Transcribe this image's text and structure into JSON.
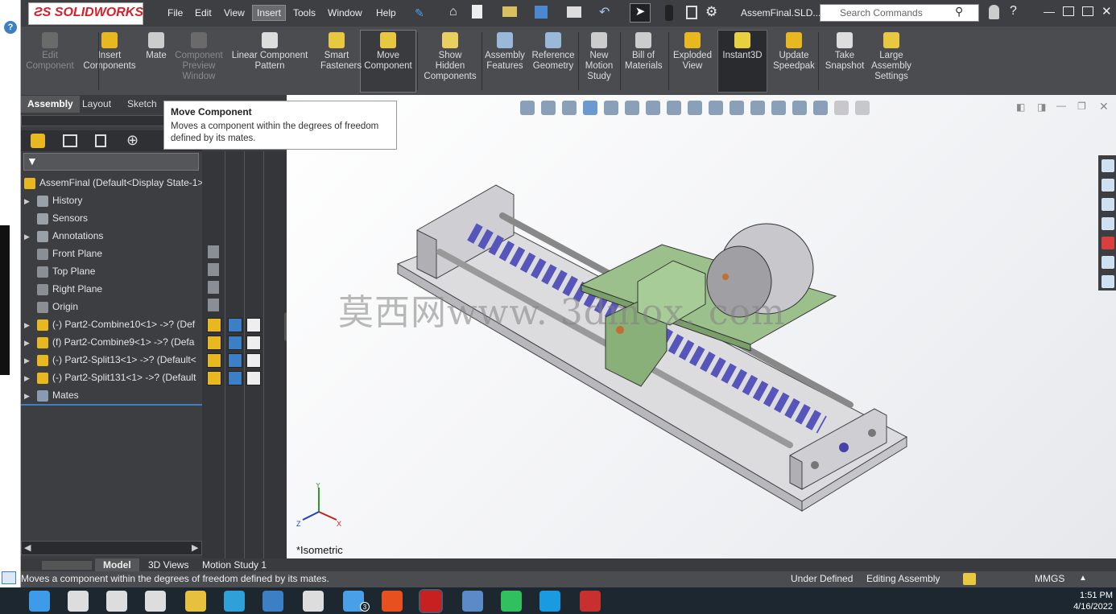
{
  "app": {
    "logo": "SOLIDWORKS",
    "document": "AssemFinal.SLD..."
  },
  "menu": [
    "File",
    "Edit",
    "View",
    "Insert",
    "Tools",
    "Window",
    "Help"
  ],
  "search": {
    "placeholder": "Search Commands"
  },
  "ribbon": [
    {
      "label": "Edit Component",
      "disabled": true,
      "icon": "edit-component-icon"
    },
    {
      "label": "Insert Components",
      "disabled": false,
      "icon": "insert-components-icon"
    },
    {
      "label": "Mate",
      "disabled": false,
      "icon": "mate-icon"
    },
    {
      "label": "Component Preview Window",
      "disabled": true,
      "icon": "preview-window-icon"
    },
    {
      "label": "Linear Component Pattern",
      "disabled": false,
      "icon": "linear-pattern-icon"
    },
    {
      "label": "Smart Fasteners",
      "disabled": false,
      "icon": "smart-fasteners-icon"
    },
    {
      "label": "Move Component",
      "disabled": false,
      "icon": "move-component-icon"
    },
    {
      "label": "Show Hidden Components",
      "disabled": false,
      "icon": "show-hidden-icon"
    },
    {
      "label": "Assembly Features",
      "disabled": false,
      "icon": "assembly-features-icon"
    },
    {
      "label": "Reference Geometry",
      "disabled": false,
      "icon": "reference-geometry-icon"
    },
    {
      "label": "New Motion Study",
      "disabled": false,
      "icon": "motion-study-icon"
    },
    {
      "label": "Bill of Materials",
      "disabled": false,
      "icon": "bom-icon"
    },
    {
      "label": "Exploded View",
      "disabled": false,
      "icon": "exploded-view-icon"
    },
    {
      "label": "Instant3D",
      "disabled": false,
      "icon": "instant3d-icon"
    },
    {
      "label": "Update Speedpak",
      "disabled": false,
      "icon": "speedpak-icon"
    },
    {
      "label": "Take Snapshot",
      "disabled": false,
      "icon": "snapshot-icon"
    },
    {
      "label": "Large Assembly Settings",
      "disabled": false,
      "icon": "large-assembly-icon"
    }
  ],
  "tabs": [
    "Assembly",
    "Layout",
    "Sketch"
  ],
  "tooltip": {
    "title": "Move Component",
    "body": "Moves a component within the degrees of freedom defined by its mates."
  },
  "tree": [
    {
      "label": "AssemFinal  (Default<Display State-1>",
      "arrow": false,
      "icon_color": "#e8b820"
    },
    {
      "label": "History",
      "arrow": true,
      "icon_color": "#9aa0a8"
    },
    {
      "label": "Sensors",
      "arrow": false,
      "icon_color": "#9aa0a8"
    },
    {
      "label": "Annotations",
      "arrow": true,
      "icon_color": "#9aa0a8"
    },
    {
      "label": "Front Plane",
      "arrow": false,
      "icon_color": "#8a8f96"
    },
    {
      "label": "Top Plane",
      "arrow": false,
      "icon_color": "#8a8f96"
    },
    {
      "label": "Right Plane",
      "arrow": false,
      "icon_color": "#8a8f96"
    },
    {
      "label": "Origin",
      "arrow": false,
      "icon_color": "#8a8f96"
    },
    {
      "label": "(-) Part2-Combine10<1> ->? (Def",
      "arrow": true,
      "icon_color": "#e8b820"
    },
    {
      "label": "(f) Part2-Combine9<1> ->? (Defa",
      "arrow": true,
      "icon_color": "#e8b820"
    },
    {
      "label": "(-) Part2-Split13<1> ->? (Default<",
      "arrow": true,
      "icon_color": "#e8b820"
    },
    {
      "label": "(-) Part2-Split131<1> ->? (Default",
      "arrow": true,
      "icon_color": "#e8b820"
    },
    {
      "label": "Mates",
      "arrow": true,
      "icon_color": "#8a9ab0"
    }
  ],
  "viewport": {
    "watermark": "莫西网www. 3dmox. com",
    "view_label": "*Isometric"
  },
  "bottom_tabs": [
    "Model",
    "3D Views",
    "Motion Study 1"
  ],
  "status": {
    "message": "Moves a component within the degrees of freedom defined by its mates.",
    "state": "Under Defined",
    "mode": "Editing Assembly",
    "units": "MMGS"
  },
  "taskbar": {
    "time": "1:51 PM",
    "date": "4/16/2022",
    "badge": "3"
  },
  "colors": {
    "accent": "#3d7fc4",
    "model_green": "#8ab07a",
    "model_blue": "#5a5ac8",
    "model_grey": "#d0d0d4"
  }
}
